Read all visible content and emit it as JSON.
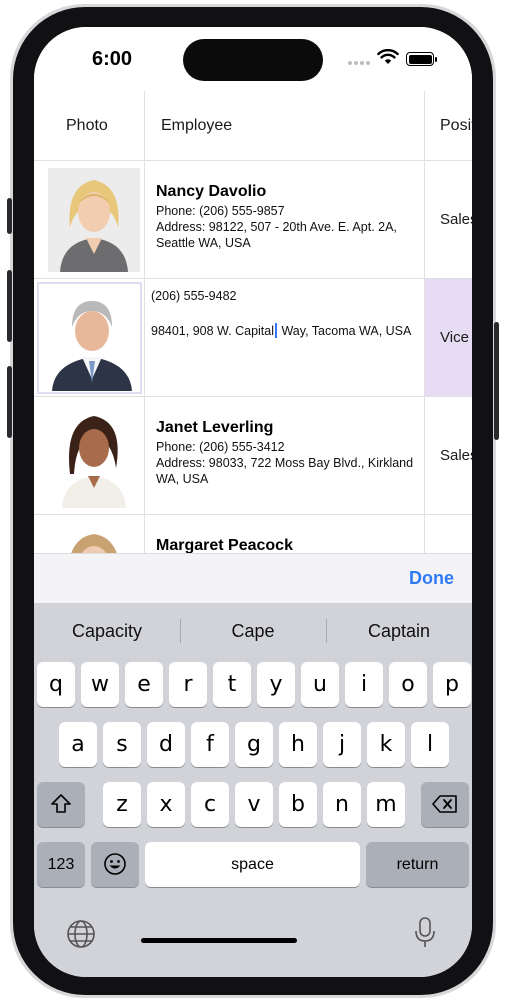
{
  "status": {
    "time": "6:00"
  },
  "grid": {
    "headers": {
      "photo": "Photo",
      "employee": "Employee",
      "position": "Position"
    },
    "rows": [
      {
        "name": "Nancy Davolio",
        "phone": "Phone: (206) 555-9857",
        "address": "Address: 98122, 507 - 20th Ave. E. Apt. 2A, Seattle WA, USA",
        "position": "Sales Representative"
      },
      {
        "phone_value": "(206) 555-9482",
        "address_before_caret": "98401, 908 W. Capital",
        "address_after_caret": " Way, Tacoma WA, USA",
        "position": "Vice President, Sales",
        "selected": true
      },
      {
        "name": "Janet Leverling",
        "phone": "Phone: (206) 555-3412",
        "address": "Address: 98033, 722 Moss Bay Blvd., Kirkland WA, USA",
        "position": "Sales Representative"
      },
      {
        "name": "Margaret Peacock"
      }
    ]
  },
  "accessory": {
    "done_label": "Done"
  },
  "keyboard": {
    "suggestions": [
      "Capacity",
      "Cape",
      "Captain"
    ],
    "row1": [
      "q",
      "w",
      "e",
      "r",
      "t",
      "y",
      "u",
      "i",
      "o",
      "p"
    ],
    "row2": [
      "a",
      "s",
      "d",
      "f",
      "g",
      "h",
      "j",
      "k",
      "l"
    ],
    "row3": [
      "z",
      "x",
      "c",
      "v",
      "b",
      "n",
      "m"
    ],
    "numbers_label": "123",
    "space_label": "space",
    "return_label": "return"
  },
  "colors": {
    "accent": "#2f7bf5",
    "selection": "#e5dcf3",
    "keyboard_bg": "#d1d3d9"
  }
}
